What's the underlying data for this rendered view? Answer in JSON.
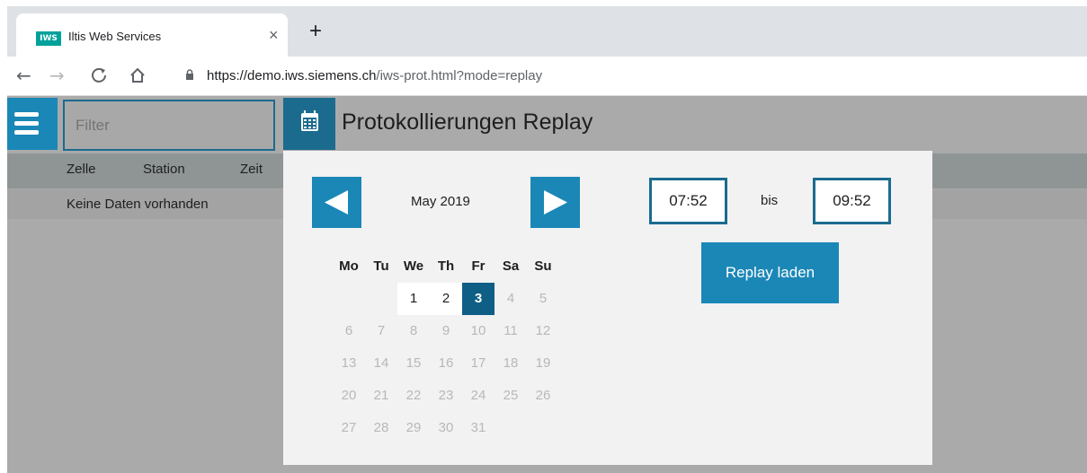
{
  "browser": {
    "tab_favicon_text": "IWS",
    "tab_title": "Iltis Web Services",
    "close_glyph": "×",
    "new_tab_glyph": "+",
    "url_host": "https://demo.iws.siemens.ch",
    "url_path": "/iws-prot.html?mode=replay"
  },
  "app": {
    "filter_placeholder": "Filter",
    "page_title": "Protokollierungen Replay",
    "columns": [
      "Zelle",
      "Station",
      "Zeit"
    ],
    "empty_text": "Keine Daten vorhanden"
  },
  "replay": {
    "month": "May 2019",
    "weekdays": [
      "Mo",
      "Tu",
      "We",
      "Th",
      "Fr",
      "Sa",
      "Su"
    ],
    "weeks": [
      [
        "",
        "",
        "1",
        "2",
        "3",
        "4",
        "5"
      ],
      [
        "6",
        "7",
        "8",
        "9",
        "10",
        "11",
        "12"
      ],
      [
        "13",
        "14",
        "15",
        "16",
        "17",
        "18",
        "19"
      ],
      [
        "20",
        "21",
        "22",
        "23",
        "24",
        "25",
        "26"
      ],
      [
        "27",
        "28",
        "29",
        "30",
        "31",
        "",
        ""
      ]
    ],
    "available_days": [
      "1",
      "2"
    ],
    "selected_day": "3",
    "time_from": "07:52",
    "time_separator": "bis",
    "time_to": "09:52",
    "load_button": "Replay laden"
  },
  "colors": {
    "accent": "#1b87b7",
    "accent_dark": "#0f5e86",
    "border_dark": "#1b6b8f"
  },
  "icons": [
    "back-arrow-icon",
    "forward-arrow-icon",
    "reload-icon",
    "home-icon",
    "lock-icon",
    "hamburger-menu-icon",
    "calendar-icon",
    "prev-month-icon",
    "next-month-icon"
  ]
}
